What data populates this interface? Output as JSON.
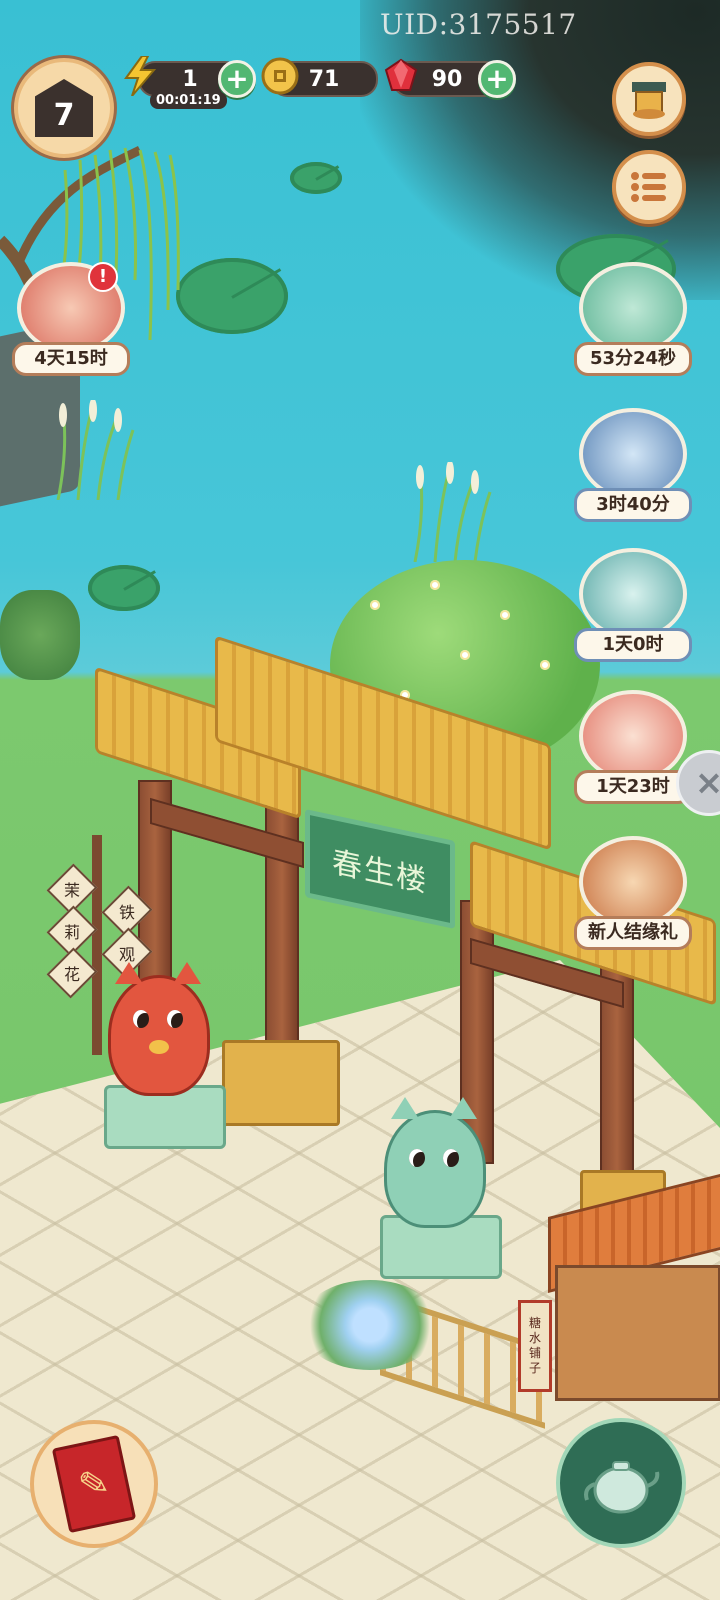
{
  "hud": {
    "uid": "UID:3175517",
    "level": "7",
    "energy": {
      "value": "1",
      "timer": "00:01:19"
    },
    "coins": {
      "value": "71"
    },
    "gems": {
      "value": "90"
    }
  },
  "icons": {
    "energy": "lightning-icon",
    "coin": "coin-icon",
    "gem": "gem-icon",
    "add": "plus-icon",
    "shop": "treasure-pavilion-icon",
    "menu": "list-menu-icon",
    "book": "book-icon",
    "teapot": "teapot-icon",
    "close": "close-icon"
  },
  "events": [
    {
      "id": "scroll-event",
      "timer": "4天15时",
      "has_alert": true
    },
    {
      "id": "coin-cart-event",
      "timer": "53分24秒"
    },
    {
      "id": "blue-box-event",
      "timer": "3时40分"
    },
    {
      "id": "gift-box-event",
      "timer": "1天0时"
    },
    {
      "id": "girl-event",
      "timer": "1天23时"
    },
    {
      "id": "newbie-gift",
      "timer": "新人结缘礼"
    }
  ],
  "alert_mark": "!",
  "scene": {
    "gate_sign": "春生楼",
    "shop_sign_left": [
      "茉",
      "莉",
      "花"
    ],
    "shop_sign_right": [
      "铁",
      "观"
    ],
    "stall_sign": [
      "糖",
      "水",
      "铺",
      "子"
    ]
  },
  "colors": {
    "water": "#39c0d3",
    "grass": "#74c46a",
    "plus_green": "#52b772",
    "pill_dark": "#3a312e",
    "gate_sign_green": "#3f8d62"
  }
}
